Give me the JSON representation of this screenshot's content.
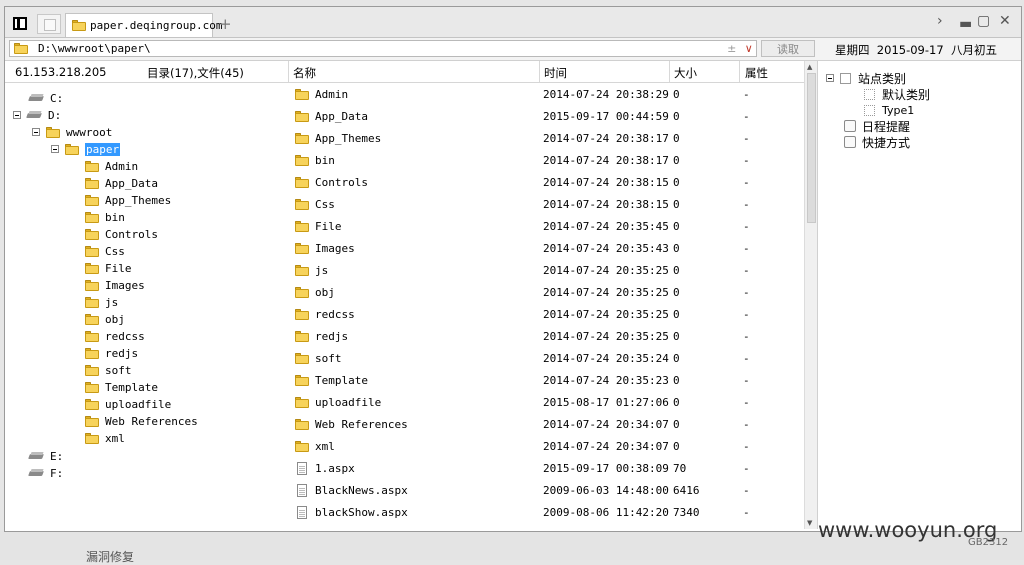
{
  "tab": {
    "title": "paper.deqingroup.com",
    "new_tab": "+"
  },
  "address": {
    "path": "D:\\wwwroot\\paper\\",
    "read_button": "读取",
    "pin": "±",
    "dropdown": "∨"
  },
  "date": "星期四  2015-09-17  八月初五",
  "header": {
    "ip": "61.153.218.205",
    "summary": "目录(17),文件(45)",
    "col_name": "名称",
    "col_time": "时间",
    "col_size": "大小",
    "col_attr": "属性"
  },
  "tree": {
    "drive_c": "C:",
    "drive_d": "D:",
    "wwwroot": "wwwroot",
    "paper": "paper",
    "children": [
      "Admin",
      "App_Data",
      "App_Themes",
      "bin",
      "Controls",
      "Css",
      "File",
      "Images",
      "js",
      "obj",
      "redcss",
      "redjs",
      "soft",
      "Template",
      "uploadfile",
      "Web References",
      "xml"
    ],
    "drive_e": "E:",
    "drive_f": "F:"
  },
  "files": [
    {
      "name": "Admin",
      "time": "2014-07-24 20:38:29",
      "size": "0",
      "attr": "-",
      "type": "folder"
    },
    {
      "name": "App_Data",
      "time": "2015-09-17 00:44:59",
      "size": "0",
      "attr": "-",
      "type": "folder"
    },
    {
      "name": "App_Themes",
      "time": "2014-07-24 20:38:17",
      "size": "0",
      "attr": "-",
      "type": "folder"
    },
    {
      "name": "bin",
      "time": "2014-07-24 20:38:17",
      "size": "0",
      "attr": "-",
      "type": "folder"
    },
    {
      "name": "Controls",
      "time": "2014-07-24 20:38:15",
      "size": "0",
      "attr": "-",
      "type": "folder"
    },
    {
      "name": "Css",
      "time": "2014-07-24 20:38:15",
      "size": "0",
      "attr": "-",
      "type": "folder"
    },
    {
      "name": "File",
      "time": "2014-07-24 20:35:45",
      "size": "0",
      "attr": "-",
      "type": "folder"
    },
    {
      "name": "Images",
      "time": "2014-07-24 20:35:43",
      "size": "0",
      "attr": "-",
      "type": "folder"
    },
    {
      "name": "js",
      "time": "2014-07-24 20:35:25",
      "size": "0",
      "attr": "-",
      "type": "folder"
    },
    {
      "name": "obj",
      "time": "2014-07-24 20:35:25",
      "size": "0",
      "attr": "-",
      "type": "folder"
    },
    {
      "name": "redcss",
      "time": "2014-07-24 20:35:25",
      "size": "0",
      "attr": "-",
      "type": "folder"
    },
    {
      "name": "redjs",
      "time": "2014-07-24 20:35:25",
      "size": "0",
      "attr": "-",
      "type": "folder"
    },
    {
      "name": "soft",
      "time": "2014-07-24 20:35:24",
      "size": "0",
      "attr": "-",
      "type": "folder"
    },
    {
      "name": "Template",
      "time": "2014-07-24 20:35:23",
      "size": "0",
      "attr": "-",
      "type": "folder"
    },
    {
      "name": "uploadfile",
      "time": "2015-08-17 01:27:06",
      "size": "0",
      "attr": "-",
      "type": "folder"
    },
    {
      "name": "Web References",
      "time": "2014-07-24 20:34:07",
      "size": "0",
      "attr": "-",
      "type": "folder"
    },
    {
      "name": "xml",
      "time": "2014-07-24 20:34:07",
      "size": "0",
      "attr": "-",
      "type": "folder"
    },
    {
      "name": "1.aspx",
      "time": "2015-09-17 00:38:09",
      "size": "70",
      "attr": "-",
      "type": "file"
    },
    {
      "name": "BlackNews.aspx",
      "time": "2009-06-03 14:48:00",
      "size": "6416",
      "attr": "-",
      "type": "file"
    },
    {
      "name": "blackShow.aspx",
      "time": "2009-08-06 11:42:20",
      "size": "7340",
      "attr": "-",
      "type": "file"
    }
  ],
  "right_panel": {
    "site_category": "站点类别",
    "default_category": "默认类别",
    "type1": "Type1",
    "reminder": "日程提醒",
    "shortcut": "快捷方式"
  },
  "watermark": "www.wooyun.org",
  "encoding": "GB2312",
  "bottom_ghost": "漏洞修复"
}
